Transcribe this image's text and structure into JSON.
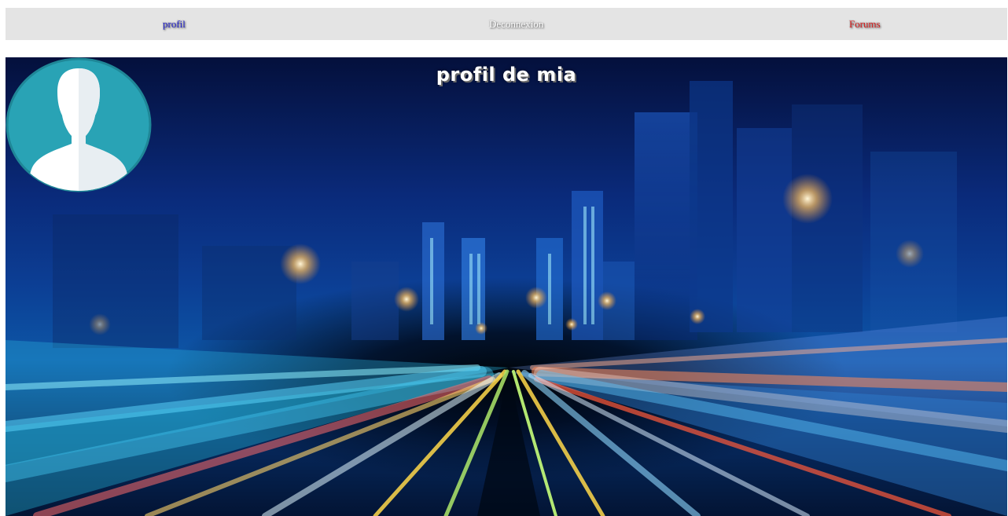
{
  "nav": {
    "profil": "profil",
    "deconnexion": "Deconnexion",
    "forums": "Forums"
  },
  "profile": {
    "title": "profil de mia"
  },
  "colors": {
    "nav_bg": "#e4e4e4",
    "profil_link": "#2020c8",
    "deconnexion_link": "#ffffff",
    "forums_link": "#d41f1f",
    "avatar_circle": "#29a3b5",
    "avatar_border": "#1f8797",
    "silhouette": "#ffffff"
  },
  "icons": {
    "avatar": "user-silhouette-icon"
  }
}
